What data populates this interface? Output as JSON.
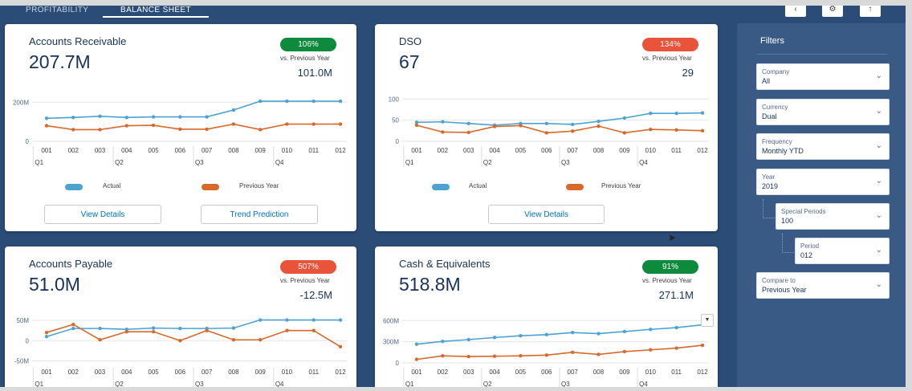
{
  "tabs": [
    {
      "label": "PROFITABILITY",
      "active": false
    },
    {
      "label": "BALANCE SHEET",
      "active": true
    }
  ],
  "top_buttons": [
    "‹",
    "⚙",
    "↑"
  ],
  "colors": {
    "actual": "#4ba3d3",
    "previous": "#d9692b",
    "badge_green": "#0e8a3c",
    "badge_red": "#e9533a",
    "background": "#2b4c76",
    "button_text": "#0070d2"
  },
  "cards": [
    {
      "title": "Accounts Receivable",
      "value": "207.7M",
      "badge": "106%",
      "badge_color": "green",
      "vs_label": "vs. Previous Year",
      "prev_value": "101.0M",
      "legend": [
        "Actual",
        "Previous Year"
      ],
      "buttons": [
        "View Details",
        "Trend Prediction"
      ]
    },
    {
      "title": "DSO",
      "value": "67",
      "badge": "134%",
      "badge_color": "red",
      "vs_label": "vs. Previous Year",
      "prev_value": "29",
      "legend": [
        "Actual",
        "Previous Year"
      ],
      "buttons": [
        "View Details"
      ]
    },
    {
      "title": "Accounts Payable",
      "value": "51.0M",
      "badge": "507%",
      "badge_color": "red",
      "vs_label": "vs. Previous Year",
      "prev_value": "-12.5M"
    },
    {
      "title": "Cash & Equivalents",
      "value": "518.8M",
      "badge": "91%",
      "badge_color": "green",
      "vs_label": "vs. Previous Year",
      "prev_value": "271.1M"
    }
  ],
  "chart_data": [
    {
      "type": "line",
      "x": [
        "001",
        "002",
        "003",
        "004",
        "005",
        "006",
        "007",
        "008",
        "009",
        "010",
        "011",
        "012"
      ],
      "quarters": [
        "Q1",
        "Q2",
        "Q3",
        "Q4"
      ],
      "ytick_labels": [
        "200M",
        "0"
      ],
      "yticks": [
        200,
        0
      ],
      "ylim": [
        0,
        230
      ],
      "series": [
        {
          "name": "Actual",
          "values": [
            118,
            122,
            128,
            122,
            125,
            125,
            125,
            160,
            205,
            205,
            205,
            205
          ]
        },
        {
          "name": "Previous Year",
          "values": [
            80,
            60,
            60,
            80,
            82,
            62,
            62,
            88,
            60,
            88,
            88,
            88
          ]
        }
      ]
    },
    {
      "type": "line",
      "x": [
        "001",
        "002",
        "003",
        "004",
        "005",
        "006",
        "007",
        "008",
        "009",
        "010",
        "011",
        "012"
      ],
      "quarters": [
        "Q1",
        "Q2",
        "Q3",
        "Q4"
      ],
      "ytick_labels": [
        "100",
        "50",
        "0"
      ],
      "yticks": [
        100,
        50,
        0
      ],
      "ylim": [
        0,
        110
      ],
      "series": [
        {
          "name": "Actual",
          "values": [
            45,
            46,
            42,
            38,
            42,
            42,
            40,
            47,
            55,
            66,
            66,
            67
          ]
        },
        {
          "name": "Previous Year",
          "values": [
            38,
            22,
            21,
            35,
            37,
            20,
            24,
            36,
            20,
            28,
            27,
            25
          ]
        }
      ]
    },
    {
      "type": "line",
      "x": [
        "001",
        "002",
        "003",
        "004",
        "005",
        "006",
        "007",
        "008",
        "009",
        "010",
        "011",
        "012"
      ],
      "quarters": [
        "Q1",
        "Q2",
        "Q3",
        "Q4"
      ],
      "ytick_labels": [
        "50M",
        "0",
        "-50M"
      ],
      "yticks": [
        50,
        0,
        -50
      ],
      "ylim": [
        -55,
        60
      ],
      "series": [
        {
          "name": "Actual",
          "values": [
            10,
            30,
            30,
            28,
            31,
            30,
            30,
            31,
            51,
            51,
            51,
            51
          ]
        },
        {
          "name": "Previous Year",
          "values": [
            20,
            40,
            2,
            22,
            22,
            0,
            25,
            2,
            2,
            25,
            25,
            -15
          ]
        }
      ]
    },
    {
      "type": "line",
      "x": [
        "001",
        "002",
        "003",
        "004",
        "005",
        "006",
        "007",
        "008",
        "009",
        "010",
        "011",
        "012"
      ],
      "quarters": [
        "Q1",
        "Q2",
        "Q3",
        "Q4"
      ],
      "ytick_labels": [
        "600M",
        "300M",
        "0"
      ],
      "yticks": [
        600,
        300,
        0
      ],
      "ylim": [
        0,
        660
      ],
      "series": [
        {
          "name": "Actual",
          "values": [
            265,
            305,
            330,
            360,
            385,
            400,
            430,
            415,
            445,
            475,
            500,
            540
          ]
        },
        {
          "name": "Previous Year",
          "values": [
            50,
            100,
            90,
            95,
            100,
            110,
            150,
            120,
            160,
            185,
            210,
            250
          ]
        }
      ]
    }
  ],
  "filters": {
    "title": "Filters",
    "items": [
      {
        "label": "Company",
        "value": "All"
      },
      {
        "label": "Currency",
        "value": "Dual"
      },
      {
        "label": "Frequency",
        "value": "Monthly YTD"
      },
      {
        "label": "Year",
        "value": "2019"
      },
      {
        "label": "Special Periods",
        "value": "100"
      },
      {
        "label": "Period",
        "value": "012"
      },
      {
        "label": "Compare to",
        "value": "Previous Year"
      }
    ]
  }
}
